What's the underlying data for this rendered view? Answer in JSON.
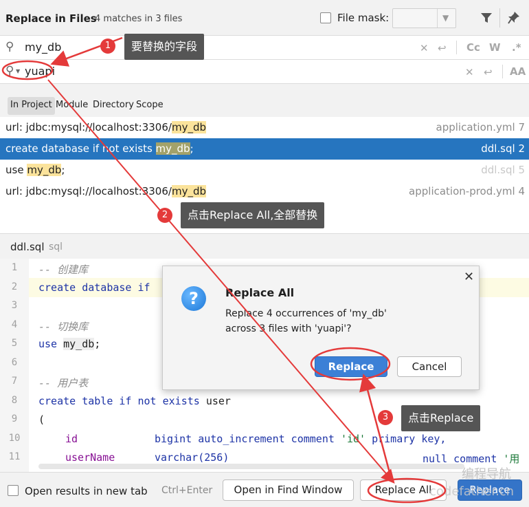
{
  "header": {
    "title": "Replace in Files",
    "subtitle": "4 matches in 3 files",
    "file_mask_label": "File mask:",
    "filter_icon": "filter-icon",
    "pin_icon": "pin-icon"
  },
  "search": {
    "find_value": "my_db",
    "replace_value": "yuapi",
    "find_options": [
      "Cc",
      "W",
      ".*"
    ],
    "replace_options": [
      "AA"
    ]
  },
  "scopes": [
    "In Project",
    "Module",
    "Directory",
    "Scope"
  ],
  "results": [
    {
      "prefix": "url: jdbc:mysql://localhost:3306/",
      "match": "my_db",
      "suffix": "",
      "file": "application.yml 7"
    },
    {
      "prefix": "create database if not exists ",
      "match": "my_db",
      "suffix": ";",
      "file": "ddl.sql 2"
    },
    {
      "prefix": "use ",
      "match": "my_db",
      "suffix": ";",
      "file": "ddl.sql 5"
    },
    {
      "prefix": "url: jdbc:mysql://localhost:3306/",
      "match": "my_db",
      "suffix": "",
      "file": "application-prod.yml 4"
    }
  ],
  "preview": {
    "file_name": "ddl.sql",
    "language": "sql",
    "line_numbers": [
      "1",
      "2",
      "3",
      "4",
      "5",
      "6",
      "7",
      "8",
      "9",
      "10",
      "11"
    ],
    "code": {
      "l1_comment": "-- 创建库",
      "l2_kw": "create database if",
      "l4_comment": "-- 切换库",
      "l5_kw": "use",
      "l5_id": "my_db",
      "l5_end": ";",
      "l7_comment": "-- 用户表",
      "l8_kw": "create table if not exists",
      "l8_id": "user",
      "l9": "(",
      "l10_col": "id",
      "l10_type": "bigint auto_increment comment",
      "l10_str": "'id'",
      "l10_rest": "primary key,",
      "l11_col": "userName",
      "l11_type": "varchar(256)",
      "l11_rest": "null comment",
      "l11_str": "'用"
    }
  },
  "dialog": {
    "title": "Replace All",
    "line1": "Replace 4 occurrences of 'my_db'",
    "line2": "across 3 files with 'yuapi'?",
    "replace_button": "Replace",
    "cancel_button": "Cancel"
  },
  "footer": {
    "open_new_tab_label": "Open results in new tab",
    "shortcut": "Ctrl+Enter",
    "open_find_window": "Open in Find Window",
    "replace_all": "Replace All",
    "replace": "Replace"
  },
  "annotations": {
    "step1_num": "1",
    "step1_text": "要替换的字段",
    "step2_num": "2",
    "step2_text": "点击Replace All,全部替换",
    "step3_num": "3",
    "step3_text": "点击Replace"
  },
  "watermark": {
    "cn": "编程导航",
    "en": "codefather.cn"
  },
  "colors": {
    "selection": "#2675bf",
    "match_highlight": "#fbe39b",
    "callout_bg": "#555555",
    "annotation_red": "#e43a3a",
    "primary_button": "#3474c8"
  }
}
